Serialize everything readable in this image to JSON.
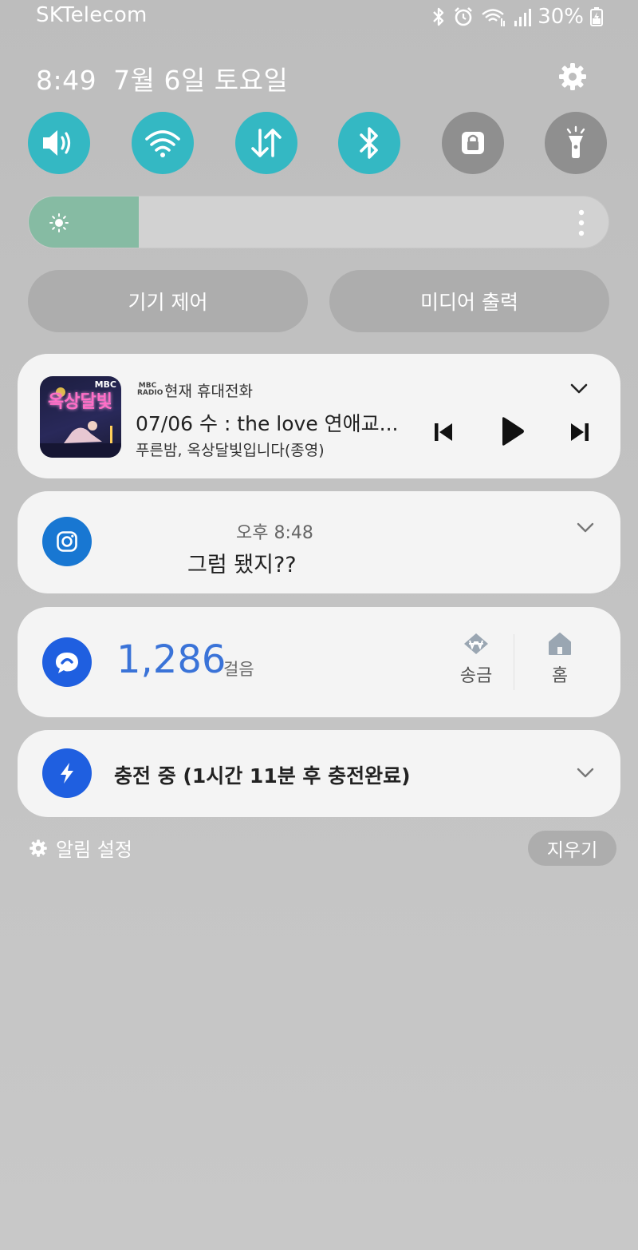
{
  "status_bar": {
    "carrier": "SKTelecom",
    "battery": "30%"
  },
  "header": {
    "time": "8:49",
    "date": "7월 6일 토요일"
  },
  "quick_toggles": [
    {
      "name": "sound",
      "state": "on"
    },
    {
      "name": "wifi",
      "state": "on"
    },
    {
      "name": "mobile-data",
      "state": "on"
    },
    {
      "name": "bluetooth",
      "state": "on"
    },
    {
      "name": "screen-lock",
      "state": "off"
    },
    {
      "name": "flashlight",
      "state": "off"
    }
  ],
  "brightness": {
    "level": 0.19
  },
  "buttons": {
    "device_control": "기기 제어",
    "media_output": "미디어 출력"
  },
  "media": {
    "album_art_text": "옥상달빛",
    "source_logo": "MBC RADIO",
    "source": "현재 휴대전화",
    "title": "07/06 수 : the love 연애교...",
    "subtitle": "푸른밤, 옥상달빛입니다(종영)"
  },
  "instagram": {
    "time": "오후 8:48",
    "message": "그럼 됐지??"
  },
  "steps": {
    "count": "1,286",
    "unit": "걸음",
    "transfer_label": "송금",
    "home_label": "홈"
  },
  "charging": {
    "text": "충전 중 (1시간 11분 후 충전완료)"
  },
  "footer": {
    "settings_label": "알림 설정",
    "clear_label": "지우기"
  },
  "colors": {
    "toggle_on": "#34b8c3",
    "toggle_off": "#8f8f8f",
    "brightness_fill": "#86bba3",
    "steps_blue": "#3a73d8",
    "instagram_blue": "#1877d2"
  }
}
